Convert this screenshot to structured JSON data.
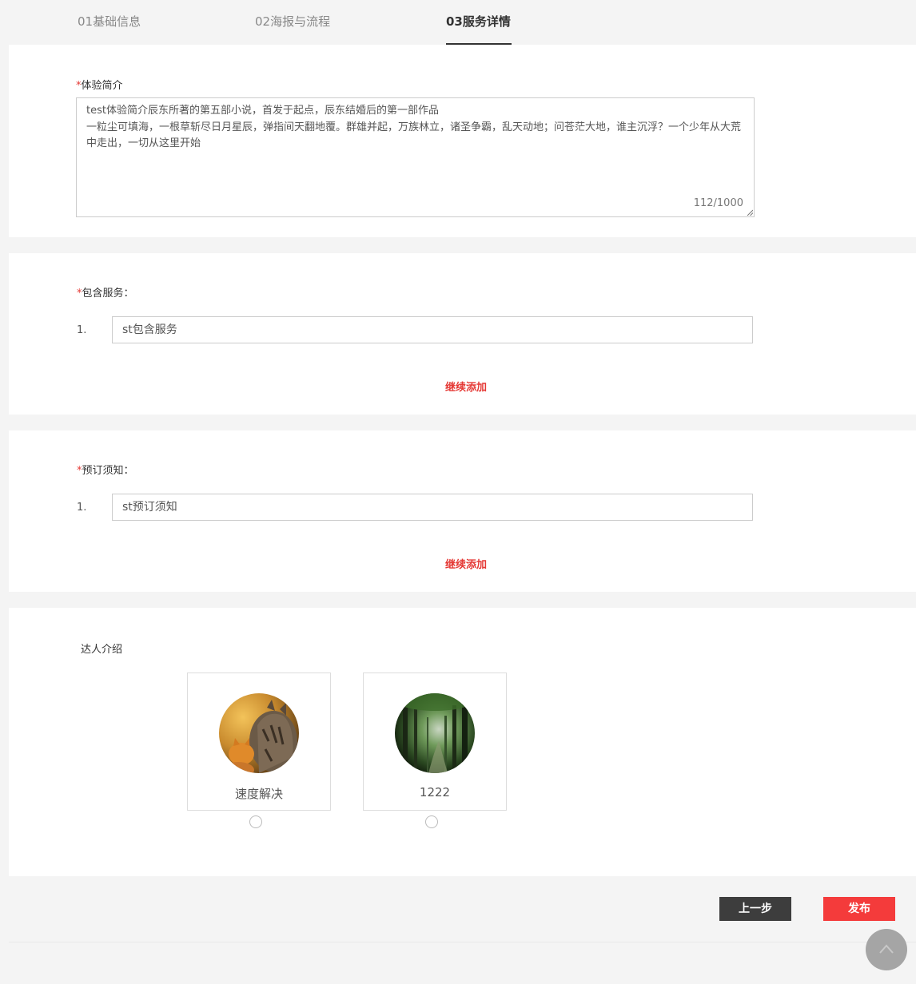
{
  "tabs": [
    {
      "label": "01基础信息",
      "active": false
    },
    {
      "label": "02海报与流程",
      "active": false
    },
    {
      "label": "03服务详情",
      "active": true
    }
  ],
  "intro": {
    "required_mark": "*",
    "label": "体验简介",
    "value": "test体验简介辰东所著的第五部小说，首发于起点，辰东结婚后的第一部作品\n一粒尘可填海，一根草斩尽日月星辰，弹指间天翻地覆。群雄并起，万族林立，诸圣争霸，乱天动地；问苍茫大地，谁主沉浮？一个少年从大荒中走出，一切从这里开始",
    "counter": "112/1000"
  },
  "services": {
    "required_mark": "*",
    "label": "包含服务：",
    "items": [
      {
        "num": "1.",
        "value": "st包含服务"
      }
    ],
    "add_label": "继续添加"
  },
  "notice": {
    "required_mark": "*",
    "label": "预订须知：",
    "items": [
      {
        "num": "1.",
        "value": "st预订须知"
      }
    ],
    "add_label": "继续添加"
  },
  "experts": {
    "label": "达人介绍",
    "cards": [
      {
        "name": "速度解决",
        "image": "cat-photo"
      },
      {
        "name": "1222",
        "image": "forest-photo"
      }
    ]
  },
  "footer": {
    "prev_label": "上一步",
    "publish_label": "发布"
  },
  "colors": {
    "accent_red": "#e53935",
    "publish_button": "#f43b3b",
    "prev_button": "#3d3d3d",
    "page_bg": "#f4f4f4"
  }
}
